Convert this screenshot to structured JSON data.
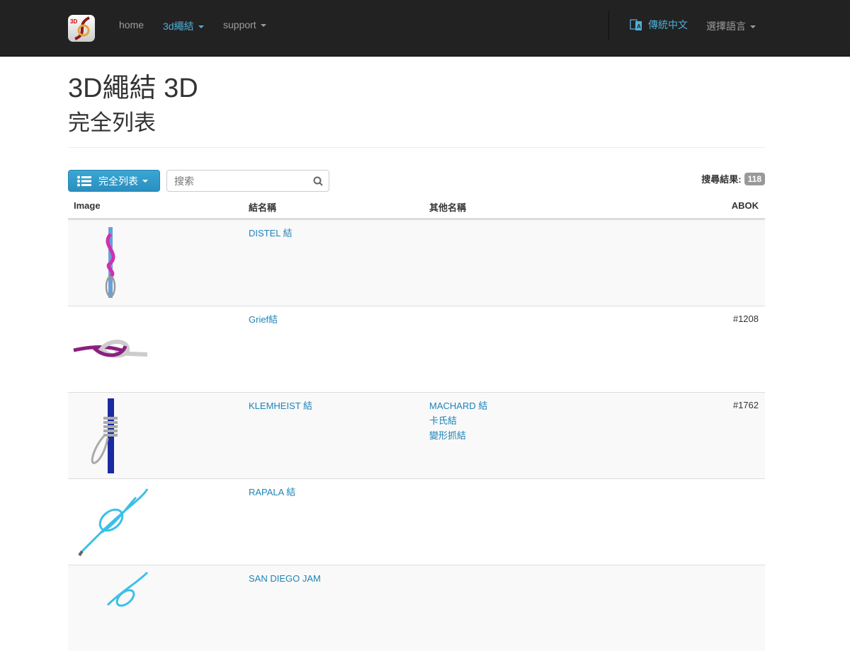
{
  "nav": {
    "home": "home",
    "knots": "3d繩結",
    "support": "support",
    "language_current": "傳統中文",
    "language_select": "選擇語言"
  },
  "header": {
    "title": "3D繩結 3D",
    "subtitle": "完全列表"
  },
  "toolbar": {
    "list_button": "完全列表",
    "search_placeholder": "搜索",
    "results_label": "搜尋結果:",
    "results_count": "118"
  },
  "table": {
    "columns": [
      "Image",
      "結名稱",
      "其他名稱",
      "ABOK"
    ],
    "rows": [
      {
        "name": "DISTEL 結",
        "other": [],
        "abok": ""
      },
      {
        "name": "Grief結",
        "other": [],
        "abok": "#1208"
      },
      {
        "name": "KLEMHEIST 結",
        "other": [
          "MACHARD 結",
          "卡氏結",
          "變形抓結"
        ],
        "abok": "#1762"
      },
      {
        "name": "RAPALA 結",
        "other": [],
        "abok": ""
      },
      {
        "name": "SAN DIEGO JAM",
        "other": [],
        "abok": ""
      }
    ]
  },
  "colors": {
    "navbar": "#222222",
    "accent": "#4fb0d8",
    "link": "#1f83b8",
    "button": "#2f9bcb"
  }
}
